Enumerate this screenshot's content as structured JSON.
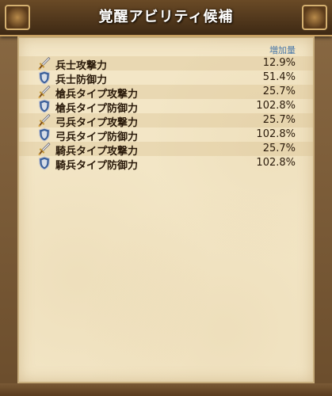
{
  "window": {
    "title": "覚醒アビリティ候補"
  },
  "table": {
    "value_header": "増加量",
    "rows": [
      {
        "icon": "sword-icon",
        "label": "兵士攻撃力",
        "value": "12.9%"
      },
      {
        "icon": "shield-icon",
        "label": "兵士防御力",
        "value": "51.4%"
      },
      {
        "icon": "sword-icon",
        "label": "槍兵タイプ攻撃力",
        "value": "25.7%"
      },
      {
        "icon": "shield-icon",
        "label": "槍兵タイプ防御力",
        "value": "102.8%"
      },
      {
        "icon": "sword-icon",
        "label": "弓兵タイプ攻撃力",
        "value": "25.7%"
      },
      {
        "icon": "shield-icon",
        "label": "弓兵タイプ防御力",
        "value": "102.8%"
      },
      {
        "icon": "sword-icon",
        "label": "騎兵タイプ攻撃力",
        "value": "25.7%"
      },
      {
        "icon": "shield-icon",
        "label": "騎兵タイプ防御力",
        "value": "102.8%"
      }
    ]
  },
  "colors": {
    "header_text": "#4a78a8",
    "panel_bg": "#f3e6c6",
    "title_bar": "#4e3319"
  }
}
